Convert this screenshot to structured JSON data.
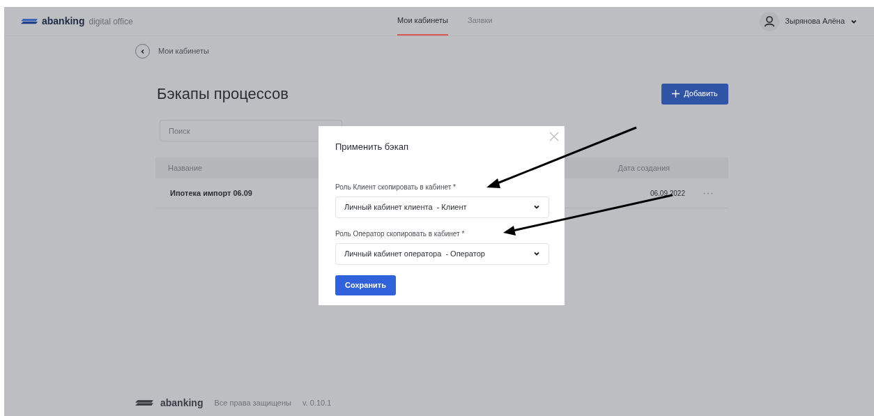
{
  "header": {
    "logo": {
      "brand": "abanking",
      "suffix": "digital office"
    },
    "tabs": [
      {
        "label": "Мои кабинеты",
        "selected": true
      },
      {
        "label": "Заявки",
        "selected": false
      }
    ],
    "user": {
      "name": "Зырянова Алёна"
    }
  },
  "breadcrumb": {
    "label": "Мои кабинеты"
  },
  "page": {
    "title": "Бэкапы процессов",
    "add_button": "Добавить",
    "search": {
      "placeholder": "Поиск"
    }
  },
  "table": {
    "columns": [
      "Название",
      "Дата создания"
    ],
    "rows": [
      {
        "name": "Ипотека импорт 06.09",
        "date": "06.09.2022"
      }
    ]
  },
  "dialog": {
    "title": "Применить бэкап",
    "fields": [
      {
        "label": "Роль Клиент скопировать в кабинет *",
        "value": "Личный кабинет клиента  - Клиент"
      },
      {
        "label": "Роль Оператор скопировать в кабинет *",
        "value": "Личный кабинет оператора  - Оператор"
      }
    ],
    "save_button": "Сохранить"
  },
  "footer": {
    "brand": "abanking",
    "rights": "Все права защищены",
    "version": "v. 0.10.1"
  }
}
